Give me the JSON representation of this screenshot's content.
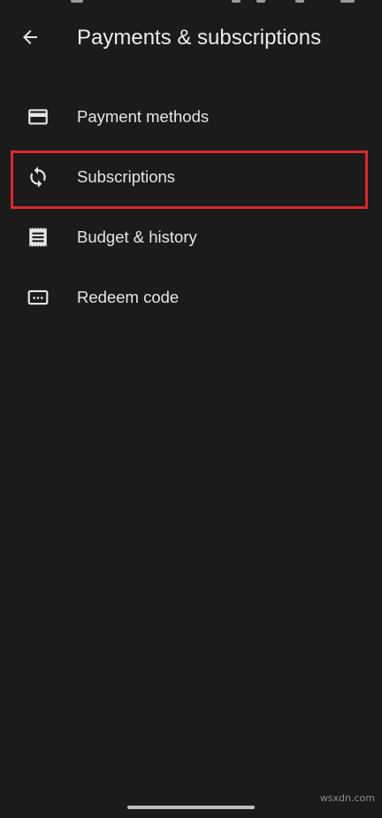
{
  "header": {
    "back_icon": "arrow-back-icon",
    "title": "Payments & subscriptions"
  },
  "menu": {
    "items": [
      {
        "label": "Payment methods",
        "icon": "credit-card-icon"
      },
      {
        "label": "Subscriptions",
        "icon": "sync-icon",
        "highlighted": true
      },
      {
        "label": "Budget & history",
        "icon": "receipt-icon"
      },
      {
        "label": "Redeem code",
        "icon": "redeem-code-icon"
      }
    ]
  },
  "colors": {
    "background": "#1b1b1b",
    "text": "#e6e6e6",
    "highlight": "#d9272e"
  },
  "watermark": "wsxdn.com"
}
